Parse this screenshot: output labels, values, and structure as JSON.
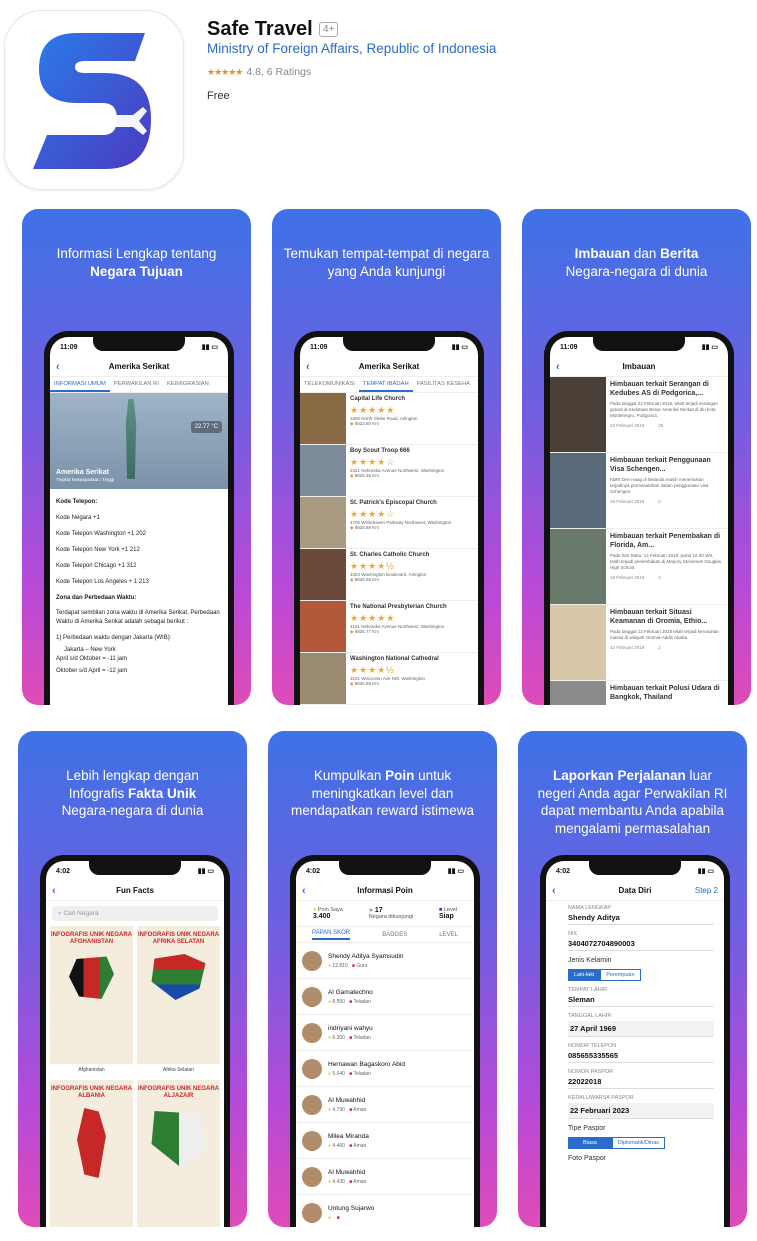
{
  "app": {
    "title": "Safe Travel",
    "age_rating": "4+",
    "developer": "Ministry of Foreign Affairs, Republic of Indonesia",
    "stars": "★★★★★",
    "rating_text": "4.8, 6 Ratings",
    "price": "Free"
  },
  "colors": {
    "accent": "#2a6cc9",
    "star": "#f08a24",
    "icon_blue": "#2b5fd9",
    "icon_purple": "#5b3fc4"
  },
  "shots": {
    "s1": {
      "caption_pre": "Informasi Lengkap tentang",
      "caption_bold": "Negara Tujuan",
      "time": "11:09",
      "nav_title": "Amerika Serikat",
      "tabs": [
        "INFORMASI UMUM",
        "PERWAKILAN RI",
        "KEIMIGRASIAN"
      ],
      "weather": "22.77 °C",
      "country": "Amerika Serikat",
      "risk": "Tingkat kewaspadaan: Tinggi",
      "lines": [
        "Kode Telepon:",
        "Kode Negara +1",
        "Kode Telepon Washington +1 202",
        "Kode Telepon New York +1 212",
        "Kode Telepon Chicago +1 312",
        "Kode Telepon Los Angeles + 1 213",
        "Zona dan Perbedaan Waktu:",
        "Terdapat sembilan zona waktu di Amerika Serikat. Perbedaan Waktu di Amerika Serikat adalah sebagai berikut :",
        "1) Perbedaan waktu dengan Jakarta (WIB):",
        "Jakarta – New York",
        "April s/d Oktober = -11 jam",
        "Oktober s/d April = -12 jam"
      ]
    },
    "s2": {
      "caption": "Temukan tempat-tempat di negara yang Anda kunjungi",
      "time": "11:09",
      "nav_title": "Amerika Serikat",
      "tabs": [
        "TELEKOMUNIKASI",
        "TEMPAT IBADAH",
        "FASILITAS KESEHA"
      ],
      "places": [
        {
          "name": "Capital Life Church",
          "stars": "★★★★★",
          "addr": "1800 North Glebe Road, Arlington",
          "dist": "8822.80 Km"
        },
        {
          "name": "Boy Scout Troop 666",
          "stars": "★★★★☆",
          "addr": "2421 Nebraska Avenue Northwest, Washington",
          "dist": "8826.35 Km"
        },
        {
          "name": "St. Patrick's Episcopal Church",
          "stars": "★★★★☆",
          "addr": "4700 Whitehaven Parkway Northwest, Washington",
          "dist": "8828.89 Km"
        },
        {
          "name": "St. Charles Catholic Church",
          "stars": "★★★★½",
          "addr": "3304 Washington Boulevard, Arlington",
          "dist": "8826.55 Km"
        },
        {
          "name": "The National Presbyterian Church",
          "stars": "★★★★★",
          "addr": "4101 Nebraska Avenue Northwest, Washington",
          "dist": "8826.77 Km"
        },
        {
          "name": "Washington National Cathedral",
          "stars": "★★★★½",
          "addr": "3101 Wisconsin Ave NW, Washington",
          "dist": "8826.88 Km"
        }
      ]
    },
    "s3": {
      "caption_bold1": "Imbauan",
      "caption_mid": "dan",
      "caption_bold2": "Berita",
      "caption_line2": "Negara-negara di dunia",
      "time": "11:09",
      "nav_title": "Imbauan",
      "news": [
        {
          "title": "Himbauan terkait Serangan di Kedubes AS di Podgorica,...",
          "desc": "Pada tanggal 22 Februari 2018, telah terjadi serangan granat di Kedutaan Besar Amerika Serikat di ibu kota Montenegro, Podgorica.",
          "date": "22 Februari 2018",
          "count": "35"
        },
        {
          "title": "Himbauan terkait Penggunaan Visa Schengen...",
          "desc": "KBRI Den Haag di Belanda masih menemukan terjadinya permasalahan dalam penggunaan visa Schengen.",
          "date": "16 Februari 2018",
          "count": "0"
        },
        {
          "title": "Himbauan terkait Penembakan di Florida, Am...",
          "desc": "Pada hari Rabu, 14 Februari 2018, pukul 15.00 WS, telah terjadi penembakan di Marjory Stoneman Douglas High School.",
          "date": "16 Februari 2018",
          "count": "2"
        },
        {
          "title": "Himbauan terkait Situasi Keamanan di Oromia, Ethio...",
          "desc": "Pada tanggal 12 Februari 2018 telah terjadi kerusuhan massa di wilayah Oromia-Addis Ababa.",
          "date": "13 Februari 2018",
          "count": "2"
        },
        {
          "title": "Himbauan terkait Polusi Udara di Bangkok, Thailand",
          "desc": "",
          "date": "",
          "count": ""
        }
      ]
    },
    "s4": {
      "caption_l1": "Lebih lengkap dengan",
      "caption_l2a": "Infografis",
      "caption_l2b": "Fakta Unik",
      "caption_l3": "Negara-negara di dunia",
      "time": "4:02",
      "nav_title": "Fun Facts",
      "search_placeholder": "Cari Negara",
      "cards": [
        {
          "title": "INFOGRAFIS UNIK NEGARA AFGHANISTAN",
          "label": "Afghanistan"
        },
        {
          "title": "INFOGRAFIS UNIK NEGARA AFRIKA SELATAN",
          "label": "Afrika Selatan"
        },
        {
          "title": "INFOGRAFIS UNIK NEGARA ALBANIA",
          "label": ""
        },
        {
          "title": "INFOGRAFIS UNIK NEGARA ALJAZAIR",
          "label": ""
        }
      ]
    },
    "s5": {
      "caption_l1a": "Kumpulkan",
      "caption_l1b": "Poin",
      "caption_l1c": "untuk",
      "caption_l2": "meningkatkan level dan",
      "caption_l3": "mendapatkan reward istimewa",
      "time": "4:02",
      "nav_title": "Informasi Poin",
      "poin_label": "Poin Saya",
      "poin_value": "3.400",
      "negara_value": "17",
      "negara_label": "Negara dikunjungi",
      "level_label": "Level",
      "level_value": "Siap",
      "tabs": [
        "PAPAN SKOR",
        "BADGES",
        "LEVEL"
      ],
      "rows": [
        {
          "name": "Shendy Aditya Syamsudin",
          "points": "12.810",
          "badge": "Guru"
        },
        {
          "name": "Al Gamatechno",
          "points": "8.550",
          "badge": "Teladan"
        },
        {
          "name": "indriyani wahyu",
          "points": "6.300",
          "badge": "Teladan"
        },
        {
          "name": "Hernawan Bagaskoro Abid",
          "points": "5.640",
          "badge": "Teladan"
        },
        {
          "name": "Al Muwahhid",
          "points": "4.790",
          "badge": "Aman"
        },
        {
          "name": "Milea Miranda",
          "points": "4.460",
          "badge": "Aman"
        },
        {
          "name": "Al Muwahhid",
          "points": "4.430",
          "badge": "Aman"
        },
        {
          "name": "Untung Sujarwo",
          "points": "",
          "badge": ""
        }
      ]
    },
    "s6": {
      "caption_l1a": "Laporkan Perjalanan",
      "caption_l1b": "luar",
      "caption_l2": "negeri Anda agar Perwakilan RI",
      "caption_l3": "dapat membantu Anda apabila",
      "caption_l4": "mengalami permasalahan",
      "time": "4:02",
      "nav_title": "Data Diri",
      "step": "Step 2",
      "fields": [
        {
          "label": "NAMA LENGKAP",
          "value": "Shendy Aditya"
        },
        {
          "label": "NIK",
          "value": "3404072704890003"
        },
        {
          "label": "Jenis Kelamin",
          "value": ""
        },
        {
          "label": "TEMPAT LAHIR",
          "value": "Sleman"
        },
        {
          "label": "TANGGAL LAHIR",
          "value": "27 April 1969"
        },
        {
          "label": "NOMOR TELEPON",
          "value": "085655335565"
        },
        {
          "label": "NOMOR PASPOR",
          "value": "22022018"
        },
        {
          "label": "KEDALUWARSA PASPOR",
          "value": "22 Februari 2023"
        },
        {
          "label": "Tipe Paspor",
          "value": ""
        },
        {
          "label": "Foto Paspor",
          "value": ""
        }
      ],
      "gender_opts": [
        "Laki-laki",
        "Perempuan"
      ],
      "passport_opts": [
        "Biasa",
        "Diplomatik/Dinas"
      ]
    }
  }
}
